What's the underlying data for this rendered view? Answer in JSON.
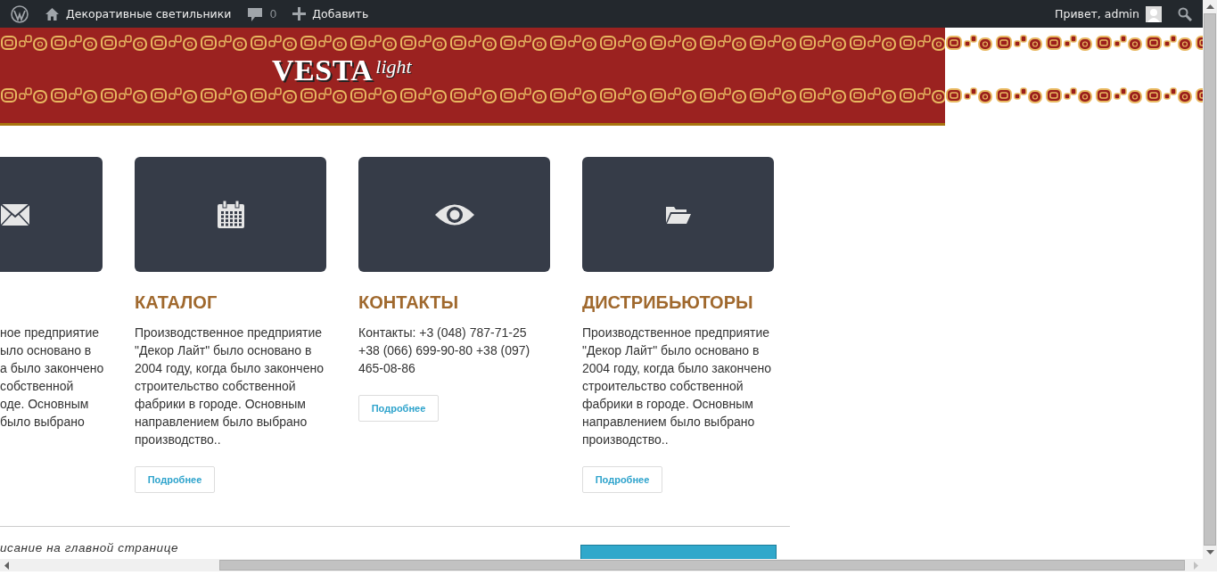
{
  "admin_bar": {
    "site_name": "Декоративные светильники",
    "comments_count": "0",
    "new_label": "Добавить",
    "greeting": "Привет, admin"
  },
  "header": {
    "logo_main": "VESTA",
    "logo_script": "light"
  },
  "columns": [
    {
      "kind": "cut",
      "lines": [
        "ное предприятие",
        "ыло основано в",
        "а было закончено",
        "собственной",
        "оде. Основным",
        "было выбрано"
      ]
    },
    {
      "kind": "full",
      "title": "КАТАЛОГ",
      "text": "Производственное предприятие \"Декор Лайт\" было основано в 2004 году, когда было закончено строительство собственной фабрики в городе. Основным направлением было выбрано производство..",
      "button": "Подробнее"
    },
    {
      "kind": "full",
      "title": "КОНТАКТЫ",
      "text": "Контакты: +3 (048) 787-71-25 +38 (066) 699-90-80 +38 (097) 465-08-86",
      "button": "Подробнее"
    },
    {
      "kind": "full",
      "title": "ДИСТРИБЬЮТОРЫ",
      "text": "Производственное предприятие \"Декор Лайт\" было основано в 2004 году, когда было закончено строительство собственной фабрики в городе. Основным направлением было выбрано производство..",
      "button": "Подробнее"
    }
  ],
  "footer_row": {
    "caption": "исание на главной странице"
  }
}
